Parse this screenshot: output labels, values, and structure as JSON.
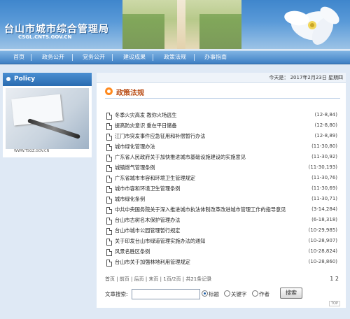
{
  "site": {
    "title": "台山市城市综合管理局",
    "subtitle": "CSGL.CNTS.GOV.CN"
  },
  "nav": {
    "items": [
      {
        "label": "首页"
      },
      {
        "label": "政务公开"
      },
      {
        "label": "党务公开"
      },
      {
        "label": "建设成果"
      },
      {
        "label": "政策法规"
      },
      {
        "label": "办事指南"
      }
    ]
  },
  "left_panel": {
    "heading": "Policy",
    "url": "WWW.TSGZ.GOV.CN"
  },
  "date_bar": {
    "text": "今天是： 2017年2月23日 星期四"
  },
  "section": {
    "title": "政策法规"
  },
  "documents": [
    {
      "title": "冬季火灾高发 教你火场逃生",
      "meta": "(12-8,84)"
    },
    {
      "title": "提高防灾意识 重在平日储备",
      "meta": "(12-8,80)"
    },
    {
      "title": "江门市突发事件应急征用和补偿暂行办法",
      "meta": "(12-8,89)"
    },
    {
      "title": "城市绿化管理办法",
      "meta": "(11-30,80)"
    },
    {
      "title": "广东省人民政府关于加快推进城市基础设施建设的实施意见",
      "meta": "(11-30,92)"
    },
    {
      "title": "城镇燃气管理条例",
      "meta": "(11-30,193)"
    },
    {
      "title": "广东省城市市容和环境卫生管理规定",
      "meta": "(11-30,76)"
    },
    {
      "title": "城市市容和环境卫生管理条例",
      "meta": "(11-30,69)"
    },
    {
      "title": "城市绿化条例",
      "meta": "(11-30,71)"
    },
    {
      "title": "中共中央国务院关于深入推进城市执法体制改革改进城市管理工作的指导意见",
      "meta": "(3-14,284)"
    },
    {
      "title": "台山市古树名木保护管理办法",
      "meta": "(6-18,318)"
    },
    {
      "title": "台山市城市公园管理暂行规定",
      "meta": "(10-29,985)"
    },
    {
      "title": "关于印发台山市绿道管理实施办法的通知",
      "meta": "(10-28,907)"
    },
    {
      "title": "风景名胜区条例",
      "meta": "(10-28,824)"
    },
    {
      "title": "台山市关于加强林地利用管理规定",
      "meta": "(10-28,860)"
    }
  ],
  "pager": {
    "first": "首页",
    "prev": "前页",
    "next": "后页",
    "last": "末页",
    "page_info": "1页/2页",
    "total": "共21条记录",
    "page_numbers": "1 2"
  },
  "search": {
    "label": "文章搜索:",
    "value": "",
    "options": [
      {
        "label": "标题",
        "selected": true
      },
      {
        "label": "关键字",
        "selected": false
      },
      {
        "label": "作者",
        "selected": false
      }
    ],
    "button": "搜索"
  },
  "colors": {
    "nav_blue": "#3d7fc4",
    "section_title": "#b84a12",
    "accent_orange": "#ff8a1f"
  }
}
